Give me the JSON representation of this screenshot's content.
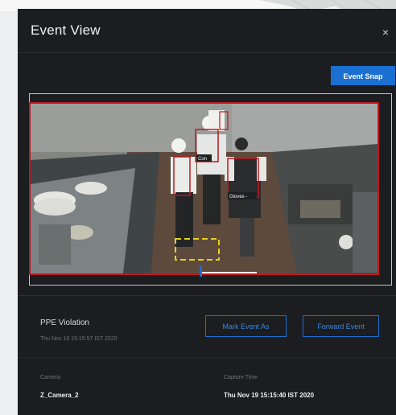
{
  "modal": {
    "title": "Event View",
    "close_icon": "×",
    "snap_label": "Event Snap"
  },
  "video": {
    "person_labels": [
      "Con",
      "Gloves -"
    ]
  },
  "event": {
    "type": "PPE Violation",
    "time": "Thu Nov 19 15:15:57 IST 2020",
    "mark_label": "Mark Event As",
    "forward_label": "Forward Event"
  },
  "details": {
    "camera_label": "Camera",
    "camera_value": "Z_Camera_2",
    "capture_label": "Capture Time",
    "capture_value": "Thu Nov 19 15:15:40 IST 2020"
  },
  "colors": {
    "accent": "#1b6fd1",
    "violation": "#c0161d",
    "zone": "#e3d21d"
  }
}
